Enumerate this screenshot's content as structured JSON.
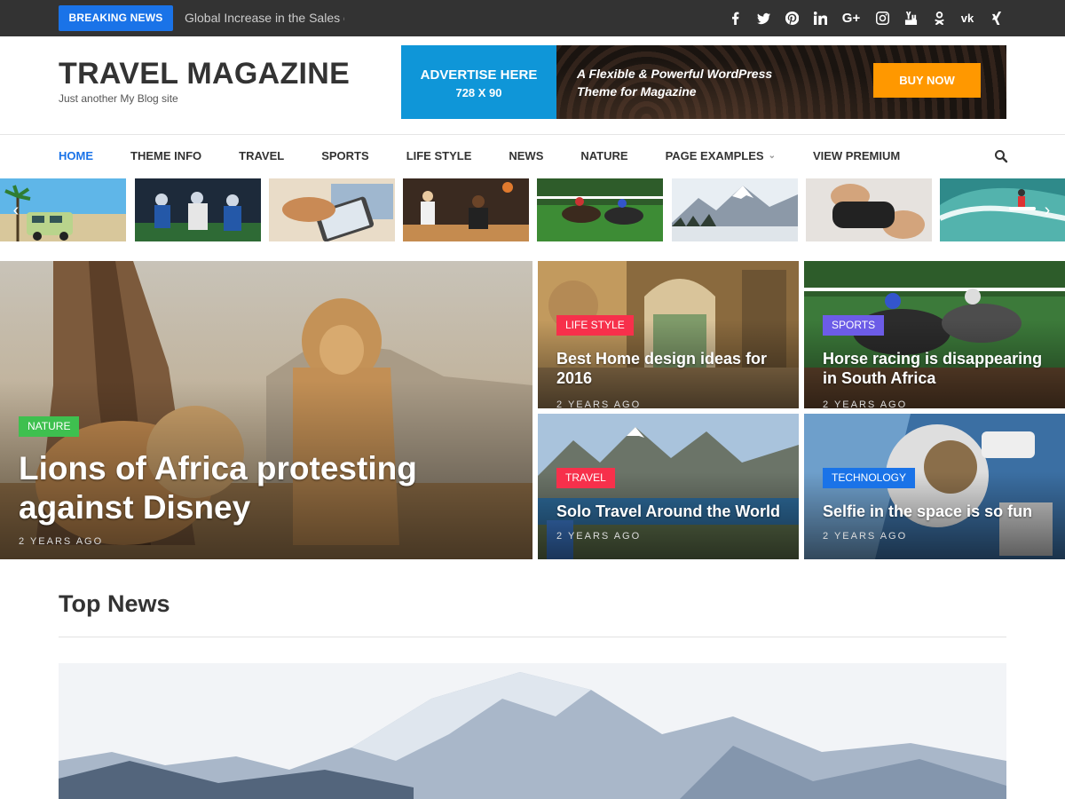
{
  "topbar": {
    "breaking_label": "BREAKING NEWS",
    "breaking_text": "Global Increase in the Sales o",
    "socials": [
      "facebook-icon",
      "twitter-icon",
      "pinterest-icon",
      "linkedin-icon",
      "google-plus-icon",
      "instagram-icon",
      "youtube-icon",
      "odnoklassniki-icon",
      "vk-icon",
      "xing-icon"
    ]
  },
  "header": {
    "title": "TRAVEL MAGAZINE",
    "tagline": "Just another My Blog site"
  },
  "ad": {
    "left_line1": "ADVERTISE HERE",
    "left_line2": "728 X 90",
    "text_line1": "A Flexible & Powerful WordPress",
    "text_line2": "Theme for Magazine",
    "button": "BUY NOW"
  },
  "nav": {
    "items": [
      "HOME",
      "THEME INFO",
      "TRAVEL",
      "SPORTS",
      "LIFE STYLE",
      "NEWS",
      "NATURE",
      "PAGE EXAMPLES",
      "VIEW PREMIUM"
    ],
    "active": "HOME"
  },
  "featured": {
    "main": {
      "category": "NATURE",
      "title": "Lions of Africa protesting against Disney",
      "date": "2 YEARS AGO"
    },
    "items": [
      {
        "category": "LIFE STYLE",
        "title": "Best Home design ideas for 2016",
        "date": "2 YEARS AGO"
      },
      {
        "category": "SPORTS",
        "title": "Horse racing is disappearing in South Africa",
        "date": "2 YEARS AGO"
      },
      {
        "category": "TRAVEL",
        "title": "Solo Travel Around the World",
        "date": "2 YEARS AGO"
      },
      {
        "category": "TECHNOLOGY",
        "title": "Selfie in the space is so fun",
        "date": "2 YEARS AGO"
      }
    ]
  },
  "colors": {
    "accent": "#1a73e8",
    "nature": "#3ec04f",
    "life_style": "#f7304b",
    "sports": "#6c5ce7",
    "travel": "#f7304b",
    "technology": "#1a73e8",
    "buy": "#ff9800"
  },
  "section": {
    "title": "Top News"
  }
}
